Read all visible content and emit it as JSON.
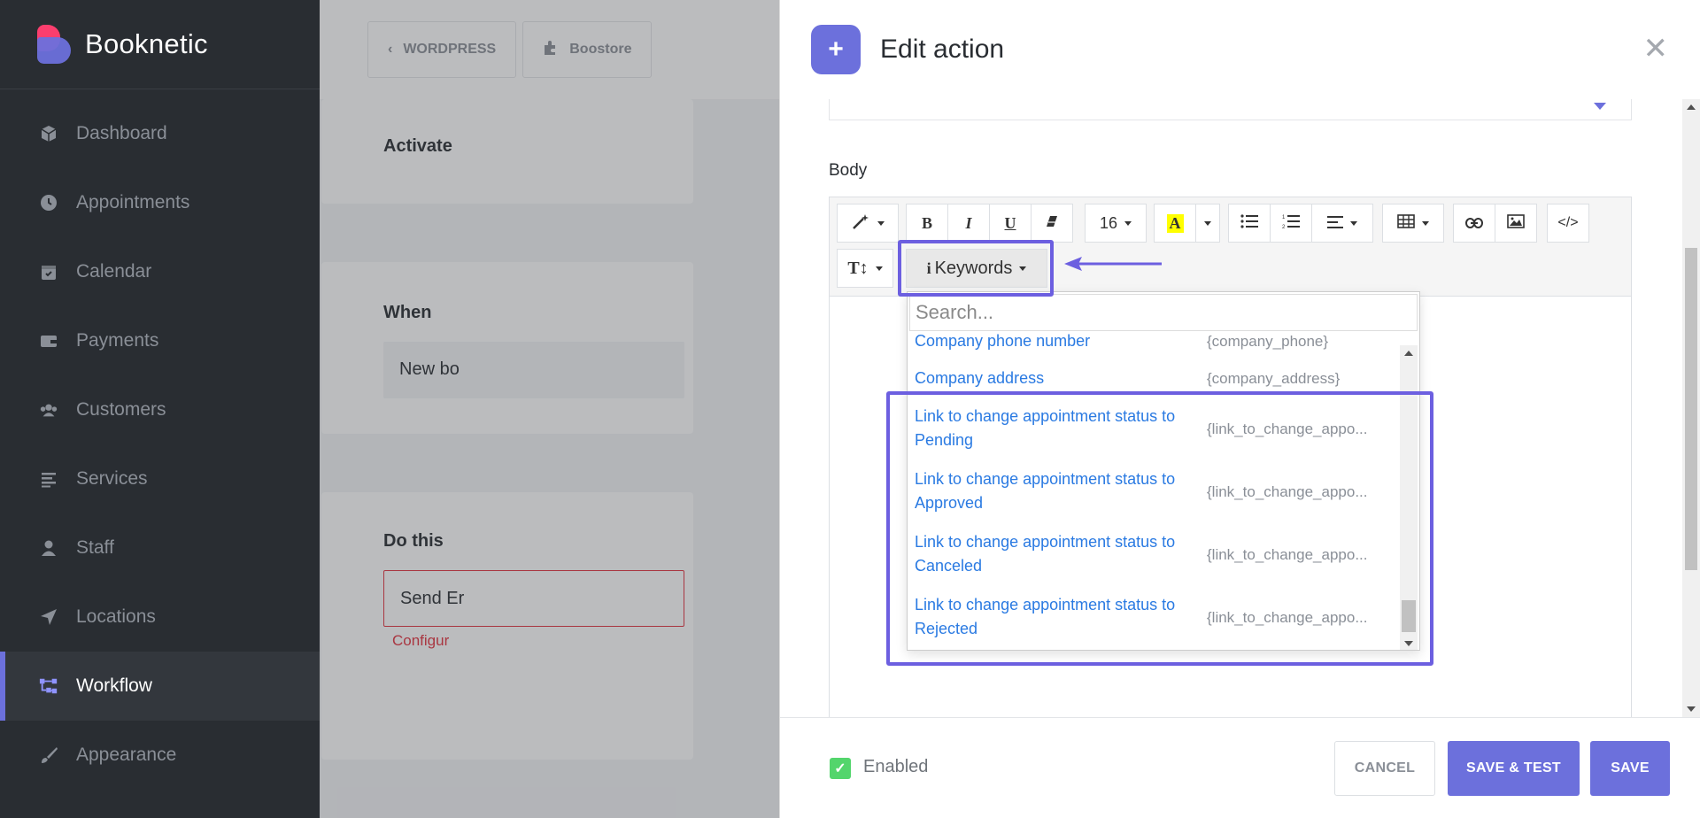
{
  "app": {
    "brand": "Booknetic"
  },
  "sidebar": {
    "items": [
      {
        "label": "Dashboard",
        "icon": "cube-icon"
      },
      {
        "label": "Appointments",
        "icon": "clock-icon"
      },
      {
        "label": "Calendar",
        "icon": "calendar-icon"
      },
      {
        "label": "Payments",
        "icon": "wallet-icon"
      },
      {
        "label": "Customers",
        "icon": "users-icon"
      },
      {
        "label": "Services",
        "icon": "list-icon"
      },
      {
        "label": "Staff",
        "icon": "user-icon"
      },
      {
        "label": "Locations",
        "icon": "location-arrow-icon"
      },
      {
        "label": "Workflow",
        "icon": "workflow-icon",
        "active": true
      },
      {
        "label": "Appearance",
        "icon": "brush-icon"
      }
    ]
  },
  "topbar": {
    "wordpress_label": "WORDPRESS",
    "boostore_label": "Boostore"
  },
  "background": {
    "activated_label": "Activate",
    "when_label": "When",
    "when_value": "New bo",
    "do_this_label": "Do this",
    "action_value": "Send Er",
    "configure_text": "Configur"
  },
  "modal": {
    "title": "Edit action",
    "body_label": "Body",
    "toolbar": {
      "font_size": "16",
      "keywords_label": "Keywords"
    },
    "search_placeholder": "Search...",
    "keywords": [
      {
        "name": "Company phone number",
        "code": "{company_phone}"
      },
      {
        "name": "Company address",
        "code": "{company_address}"
      },
      {
        "name": "Link to change appointment status to Pending",
        "code": "{link_to_change_appo..."
      },
      {
        "name": "Link to change appointment status to Approved",
        "code": "{link_to_change_appo..."
      },
      {
        "name": "Link to change appointment status to Canceled",
        "code": "{link_to_change_appo..."
      },
      {
        "name": "Link to change appointment status to Rejected",
        "code": "{link_to_change_appo..."
      }
    ],
    "footer": {
      "enabled_label": "Enabled",
      "cancel_label": "CANCEL",
      "save_test_label": "SAVE & TEST",
      "save_label": "SAVE"
    }
  },
  "colors": {
    "accent": "#6c70dc",
    "highlight": "#6c5fe0",
    "link": "#2a7ae2",
    "enabled": "#53d56c"
  }
}
